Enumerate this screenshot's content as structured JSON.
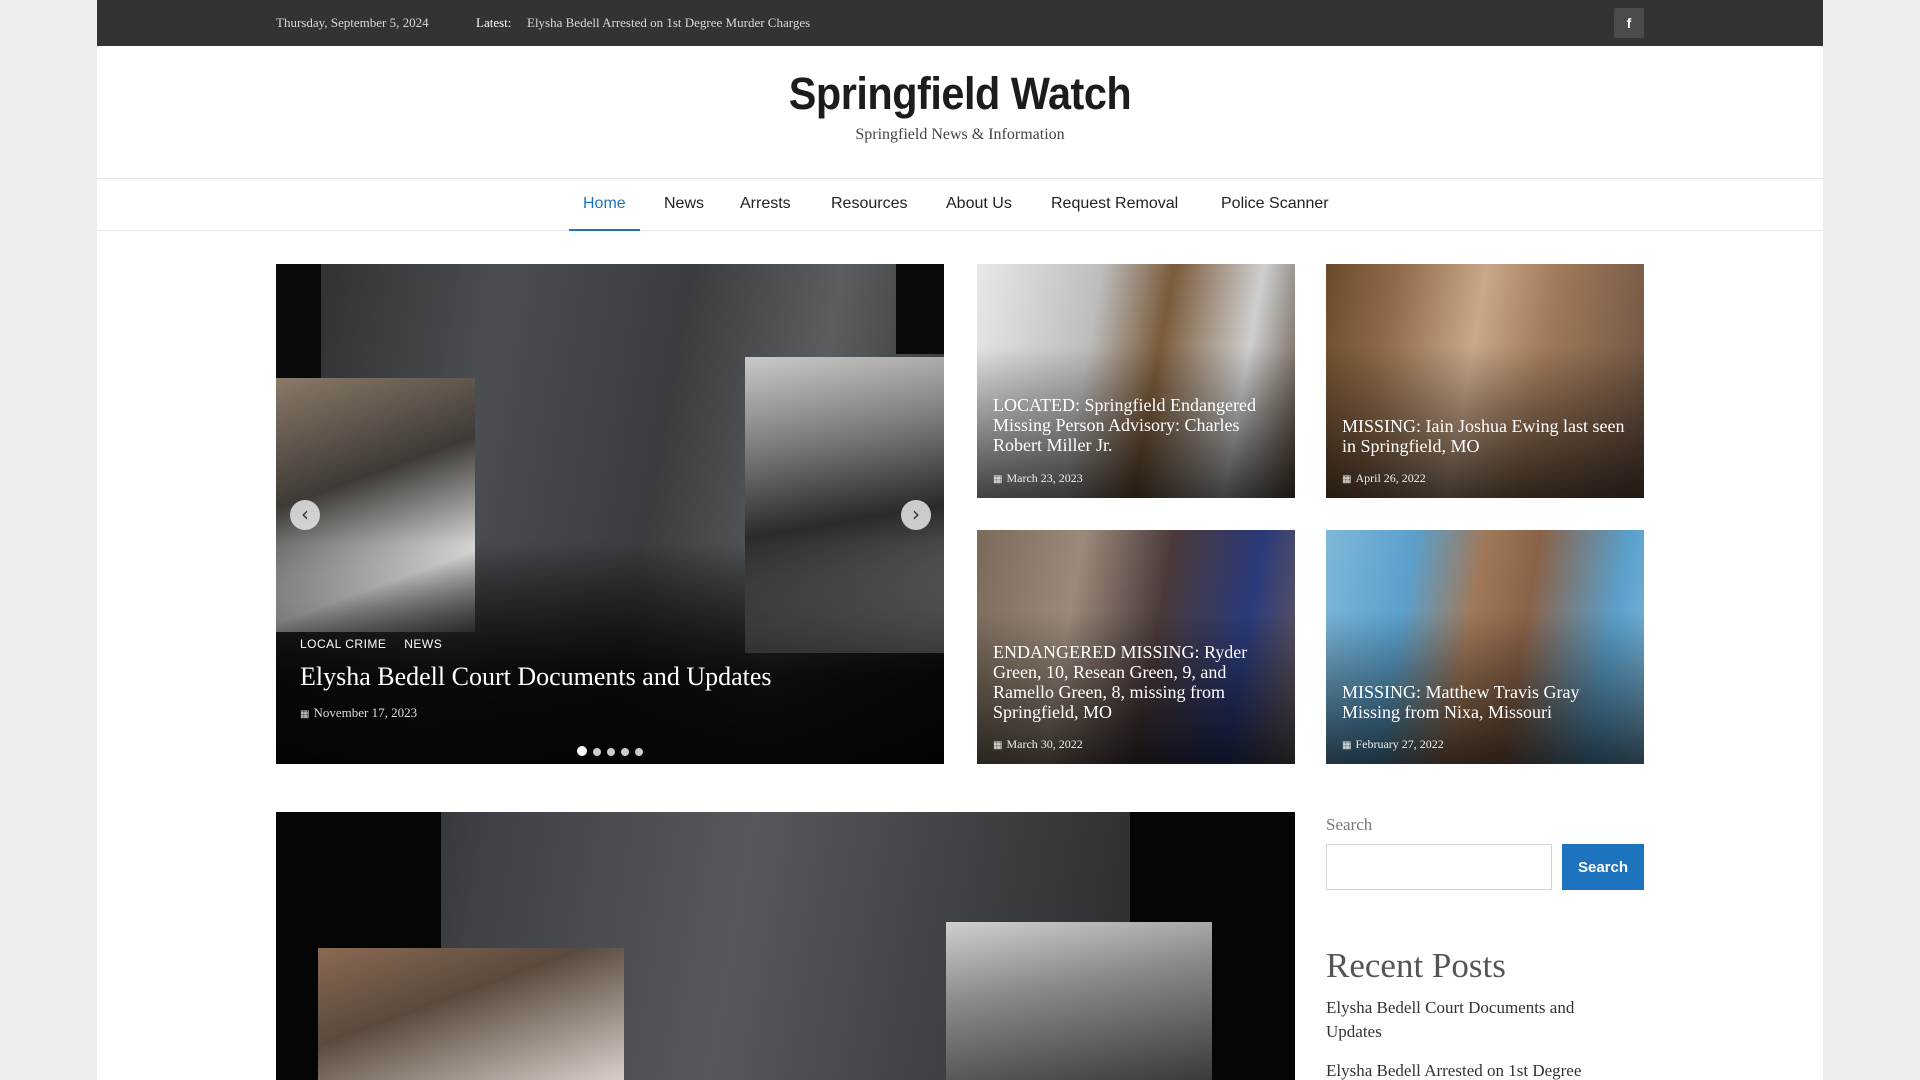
{
  "topbar": {
    "date": "Thursday, September 5, 2024",
    "latest_label": "Latest:",
    "latest_text": "Elysha Bedell Arrested on 1st Degree Murder Charges",
    "facebook_icon": "f"
  },
  "header": {
    "title": "Springfield Watch",
    "description": "Springfield News & Information"
  },
  "nav": {
    "items": [
      {
        "label": "Home"
      },
      {
        "label": "News"
      },
      {
        "label": "Arrests"
      },
      {
        "label": "Resources"
      },
      {
        "label": "About Us"
      },
      {
        "label": "Request Removal"
      },
      {
        "label": "Police Scanner"
      }
    ],
    "active": "Home"
  },
  "hero": {
    "categories": [
      "LOCAL CRIME",
      "NEWS"
    ],
    "title": "Elysha Bedell Court Documents and Updates",
    "date": "November 17, 2023",
    "prev_icon": "‹",
    "next_icon": "›",
    "slide_count": 5,
    "active_slide": 1
  },
  "cards": [
    {
      "title": "LOCATED: Springfield Endangered Missing Person Advisory: Charles Robert Miller Jr.",
      "date": "March 23, 2023"
    },
    {
      "title": "MISSING: Iain Joshua Ewing last seen in Springfield, MO",
      "date": "April 26, 2022"
    },
    {
      "title": "ENDANGERED MISSING: Ryder Green, 10, Resean Green, 9, and Ramello Green, 8, missing from Springfield, MO",
      "date": "March 30, 2022"
    },
    {
      "title": "MISSING: Matthew Travis Gray Missing from Nixa, Missouri",
      "date": "February 27, 2022"
    }
  ],
  "sidebar": {
    "search_label": "Search",
    "search_placeholder": "",
    "search_button": "Search",
    "recent_heading": "Recent Posts",
    "recent_posts": [
      "Elysha Bedell Court Documents and Updates",
      "Elysha Bedell Arrested on 1st Degree"
    ]
  },
  "colors": {
    "accent": "#1e73be",
    "topbar": "#333333"
  }
}
